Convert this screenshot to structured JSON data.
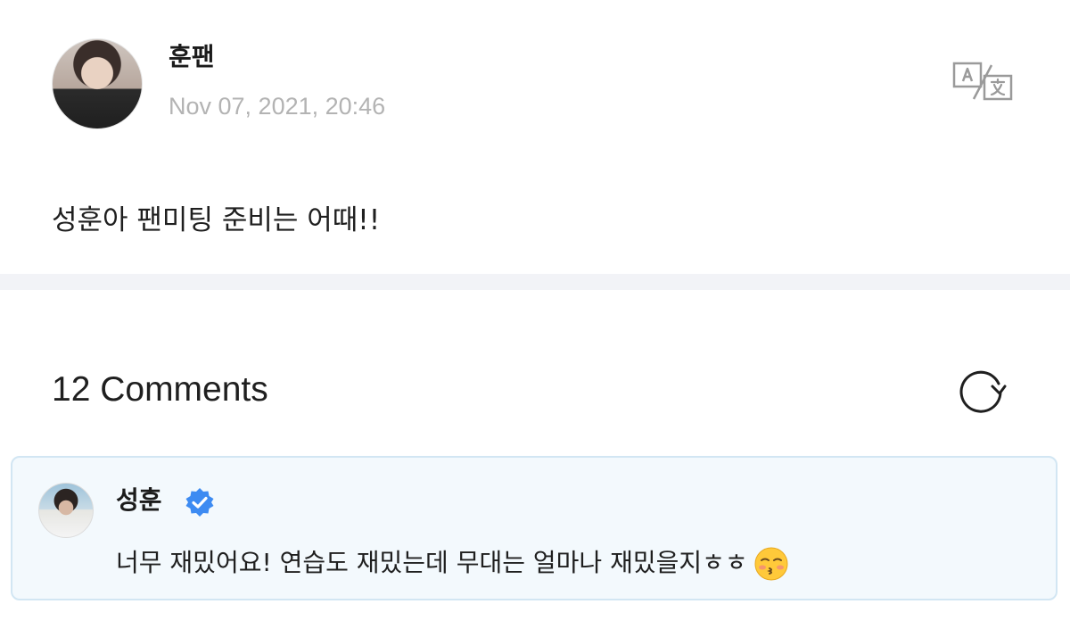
{
  "post": {
    "author_name": "훈팬",
    "timestamp": "Nov 07, 2021, 20:46",
    "body": "성훈아 팬미팅 준비는 어때!!",
    "translate_icon": "translate-icon"
  },
  "comments": {
    "header": "12 Comments",
    "refresh_icon": "refresh-icon",
    "items": [
      {
        "author": "성훈",
        "verified": true,
        "verified_icon": "verified-badge-icon",
        "text": "너무 재밌어요! 연습도 재밌는데 무대는 얼마나 재밌을지ㅎㅎ",
        "emoji": "kissing-face-with-closed-eyes"
      }
    ]
  },
  "colors": {
    "timestamp": "#b3b3b3",
    "divider": "#f2f3f7",
    "comment_bg": "#f3f9fd",
    "comment_border": "#d2e6f3",
    "verified_blue": "#3d8bf2"
  }
}
